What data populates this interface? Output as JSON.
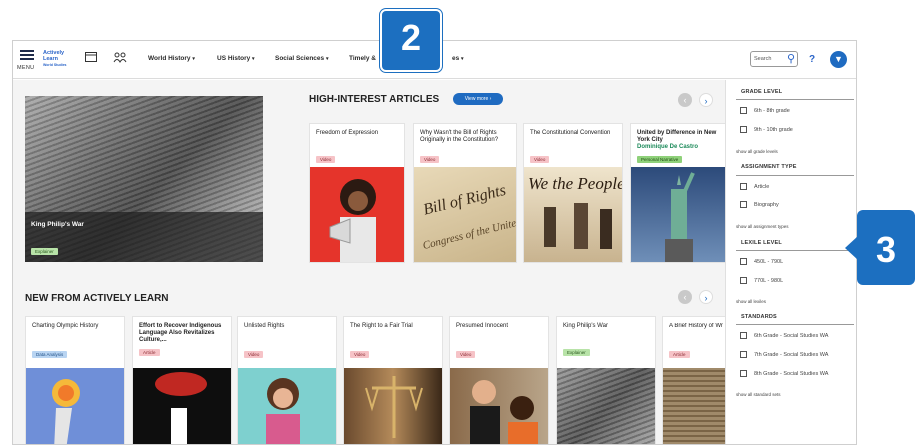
{
  "menu_label": "MENU",
  "logo": {
    "line1": "Actively",
    "line2": "Learn",
    "line3": "World Studies"
  },
  "nav": {
    "links": [
      "World History",
      "US History",
      "Social Sciences",
      "Timely &",
      "es"
    ],
    "caret": "▾"
  },
  "search": {
    "placeholder": "Search"
  },
  "help_label": "?",
  "avatar_glyph": "▼",
  "callouts": {
    "two": "2",
    "three": "3"
  },
  "hero": {
    "title": "King Philip's War",
    "tag": "Explainer"
  },
  "high_interest": {
    "title": "HIGH-INTEREST ARTICLES",
    "view_more": "View more ›",
    "prev": "‹",
    "next": "›",
    "cards": [
      {
        "title": "Freedom of Expression",
        "tag": "Video",
        "tag_type": "video",
        "image": "person-megaphone"
      },
      {
        "title": "Why Wasn't the Bill of Rights Originally in the Constitution?",
        "tag": "Video",
        "tag_type": "video",
        "image": "bill-of-rights"
      },
      {
        "title": "The Constitutional Convention",
        "tag": "Video",
        "tag_type": "video",
        "image": "we-the-people"
      },
      {
        "title": "United by Difference in New York City",
        "author": "Dominique De Castro",
        "tag": "Personal Narrative",
        "tag_type": "personal",
        "image": "statue-of-liberty"
      }
    ]
  },
  "new_from": {
    "title": "NEW FROM ACTIVELY LEARN",
    "prev": "‹",
    "next": "›",
    "cards": [
      {
        "title": "Charting Olympic History",
        "tag": "Data Analysis",
        "tag_type": "data",
        "image": "torch"
      },
      {
        "title": "Effort to Recover Indigenous Language Also Revitalizes Culture,...",
        "tag": "Article",
        "tag_type": "article",
        "image": "speech-bubble"
      },
      {
        "title": "Unlisted Rights",
        "tag": "Video",
        "tag_type": "video",
        "image": "thinking-girl"
      },
      {
        "title": "The Right to a Fair Trial",
        "tag": "Video",
        "tag_type": "video",
        "image": "scales"
      },
      {
        "title": "Presumed Innocent",
        "tag": "Video",
        "tag_type": "video",
        "image": "courtroom"
      },
      {
        "title": "King Philip's War",
        "tag": "Explainer",
        "tag_type": "explainer",
        "image": "engraving"
      },
      {
        "title": "A Brief History of Wr Language",
        "tag": "Article",
        "tag_type": "article",
        "image": "cuneiform"
      }
    ]
  },
  "filters": {
    "grade": {
      "title": "GRADE LEVEL",
      "options": [
        "6th - 8th grade",
        "9th - 10th grade"
      ],
      "more": "show all grade levels"
    },
    "assignment": {
      "title": "ASSIGNMENT TYPE",
      "options": [
        "Article",
        "Biography"
      ],
      "more": "show all assignment types"
    },
    "lexile": {
      "title": "LEXILE LEVEL",
      "options": [
        "450L - 790L",
        "770L - 980L"
      ],
      "more": "show all lexiles"
    },
    "standards": {
      "title": "STANDARDS",
      "options": [
        "6th Grade - Social Studies WA",
        "7th Grade - Social Studies WA",
        "8th Grade - Social Studies WA"
      ],
      "more": "show all standard sets"
    }
  }
}
